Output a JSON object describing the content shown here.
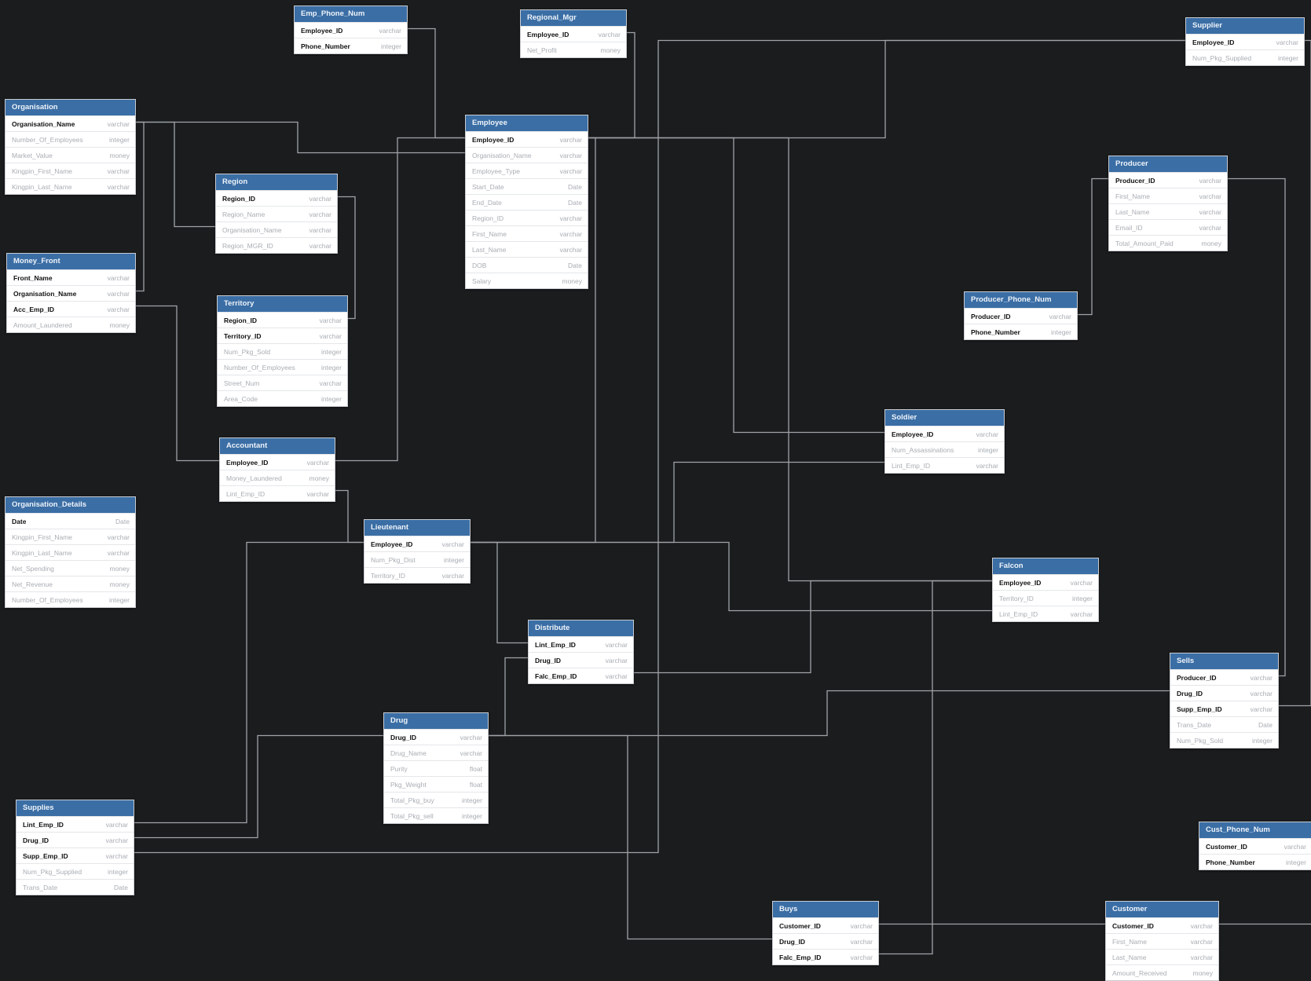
{
  "colors": {
    "background": "#1b1c1e",
    "table_header": "#3b6ea5",
    "table_body": "#ffffff",
    "connector": "#9fa3a8"
  },
  "tables": {
    "emp_phone_num": {
      "name": "Emp_Phone_Num",
      "columns": [
        {
          "name": "Employee_ID",
          "type": "varchar",
          "key": true
        },
        {
          "name": "Phone_Number",
          "type": "integer",
          "key": true
        }
      ]
    },
    "regional_mgr": {
      "name": "Regional_Mgr",
      "columns": [
        {
          "name": "Employee_ID",
          "type": "varchar",
          "key": true
        },
        {
          "name": "Net_Profit",
          "type": "money",
          "key": false
        }
      ]
    },
    "supplier": {
      "name": "Supplier",
      "columns": [
        {
          "name": "Employee_ID",
          "type": "varchar",
          "key": true
        },
        {
          "name": "Num_Pkg_Supplied",
          "type": "integer",
          "key": false
        }
      ]
    },
    "organisation": {
      "name": "Organisation",
      "columns": [
        {
          "name": "Organisation_Name",
          "type": "varchar",
          "key": true
        },
        {
          "name": "Number_Of_Employees",
          "type": "integer",
          "key": false
        },
        {
          "name": "Market_Value",
          "type": "money",
          "key": false
        },
        {
          "name": "Kingpin_First_Name",
          "type": "varchar",
          "key": false
        },
        {
          "name": "Kingpin_Last_Name",
          "type": "varchar",
          "key": false
        }
      ]
    },
    "employee": {
      "name": "Employee",
      "columns": [
        {
          "name": "Employee_ID",
          "type": "varchar",
          "key": true
        },
        {
          "name": "Organisation_Name",
          "type": "varchar",
          "key": false
        },
        {
          "name": "Employee_Type",
          "type": "varchar",
          "key": false
        },
        {
          "name": "Start_Date",
          "type": "Date",
          "key": false
        },
        {
          "name": "End_Date",
          "type": "Date",
          "key": false
        },
        {
          "name": "Region_ID",
          "type": "varchar",
          "key": false
        },
        {
          "name": "First_Name",
          "type": "varchar",
          "key": false
        },
        {
          "name": "Last_Name",
          "type": "varchar",
          "key": false
        },
        {
          "name": "DOB",
          "type": "Date",
          "key": false
        },
        {
          "name": "Salary",
          "type": "money",
          "key": false
        }
      ]
    },
    "producer": {
      "name": "Producer",
      "columns": [
        {
          "name": "Producer_ID",
          "type": "varchar",
          "key": true
        },
        {
          "name": "First_Name",
          "type": "varchar",
          "key": false
        },
        {
          "name": "Last_Name",
          "type": "varchar",
          "key": false
        },
        {
          "name": "Email_ID",
          "type": "varchar",
          "key": false
        },
        {
          "name": "Total_Amount_Paid",
          "type": "money",
          "key": false
        }
      ]
    },
    "region": {
      "name": "Region",
      "columns": [
        {
          "name": "Region_ID",
          "type": "varchar",
          "key": true
        },
        {
          "name": "Region_Name",
          "type": "varchar",
          "key": false
        },
        {
          "name": "Organisation_Name",
          "type": "varchar",
          "key": false
        },
        {
          "name": "Region_MGR_ID",
          "type": "varchar",
          "key": false
        }
      ]
    },
    "money_front": {
      "name": "Money_Front",
      "columns": [
        {
          "name": "Front_Name",
          "type": "varchar",
          "key": true
        },
        {
          "name": "Organisation_Name",
          "type": "varchar",
          "key": true
        },
        {
          "name": "Acc_Emp_ID",
          "type": "varchar",
          "key": true
        },
        {
          "name": "Amount_Laundered",
          "type": "money",
          "key": false
        }
      ]
    },
    "producer_phone_num": {
      "name": "Producer_Phone_Num",
      "columns": [
        {
          "name": "Producer_ID",
          "type": "varchar",
          "key": true
        },
        {
          "name": "Phone_Number",
          "type": "integer",
          "key": true
        }
      ]
    },
    "territory": {
      "name": "Territory",
      "columns": [
        {
          "name": "Region_ID",
          "type": "varchar",
          "key": true
        },
        {
          "name": "Territory_ID",
          "type": "varchar",
          "key": true
        },
        {
          "name": "Num_Pkg_Sold",
          "type": "integer",
          "key": false
        },
        {
          "name": "Number_Of_Employees",
          "type": "integer",
          "key": false
        },
        {
          "name": "Street_Num",
          "type": "varchar",
          "key": false
        },
        {
          "name": "Area_Code",
          "type": "integer",
          "key": false
        }
      ]
    },
    "soldier": {
      "name": "Soldier",
      "columns": [
        {
          "name": "Employee_ID",
          "type": "varchar",
          "key": true
        },
        {
          "name": "Num_Assassinations",
          "type": "integer",
          "key": false
        },
        {
          "name": "Lint_Emp_ID",
          "type": "varchar",
          "key": false
        }
      ]
    },
    "accountant": {
      "name": "Accountant",
      "columns": [
        {
          "name": "Employee_ID",
          "type": "varchar",
          "key": true
        },
        {
          "name": "Money_Laundered",
          "type": "money",
          "key": false
        },
        {
          "name": "Lint_Emp_ID",
          "type": "varchar",
          "key": false
        }
      ]
    },
    "organisation_details": {
      "name": "Organisation_Details",
      "columns": [
        {
          "name": "Date",
          "type": "Date",
          "key": true
        },
        {
          "name": "Kingpin_First_Name",
          "type": "varchar",
          "key": false
        },
        {
          "name": "Kingpin_Last_Name",
          "type": "varchar",
          "key": false
        },
        {
          "name": "Net_Spending",
          "type": "money",
          "key": false
        },
        {
          "name": "Net_Revenue",
          "type": "money",
          "key": false
        },
        {
          "name": "Number_Of_Employees",
          "type": "integer",
          "key": false
        }
      ]
    },
    "lieutenant": {
      "name": "Lieutenant",
      "columns": [
        {
          "name": "Employee_ID",
          "type": "varchar",
          "key": true
        },
        {
          "name": "Num_Pkg_Dist",
          "type": "integer",
          "key": false
        },
        {
          "name": "Territory_ID",
          "type": "varchar",
          "key": false
        }
      ]
    },
    "falcon": {
      "name": "Falcon",
      "columns": [
        {
          "name": "Employee_ID",
          "type": "varchar",
          "key": true
        },
        {
          "name": "Territory_ID",
          "type": "integer",
          "key": false
        },
        {
          "name": "Lint_Emp_ID",
          "type": "varchar",
          "key": false
        }
      ]
    },
    "distribute": {
      "name": "Distribute",
      "columns": [
        {
          "name": "Lint_Emp_ID",
          "type": "varchar",
          "key": true
        },
        {
          "name": "Drug_ID",
          "type": "varchar",
          "key": true
        },
        {
          "name": "Falc_Emp_ID",
          "type": "varchar",
          "key": true
        }
      ]
    },
    "sells": {
      "name": "Sells",
      "columns": [
        {
          "name": "Producer_ID",
          "type": "varchar",
          "key": true
        },
        {
          "name": "Drug_ID",
          "type": "varchar",
          "key": true
        },
        {
          "name": "Supp_Emp_ID",
          "type": "varchar",
          "key": true
        },
        {
          "name": "Trans_Date",
          "type": "Date",
          "key": false
        },
        {
          "name": "Num_Pkg_Sold",
          "type": "integer",
          "key": false
        }
      ]
    },
    "drug": {
      "name": "Drug",
      "columns": [
        {
          "name": "Drug_ID",
          "type": "varchar",
          "key": true
        },
        {
          "name": "Drug_Name",
          "type": "varchar",
          "key": false
        },
        {
          "name": "Purity",
          "type": "float",
          "key": false
        },
        {
          "name": "Pkg_Weight",
          "type": "float",
          "key": false
        },
        {
          "name": "Total_Pkg_buy",
          "type": "integer",
          "key": false
        },
        {
          "name": "Total_Pkg_sell",
          "type": "integer",
          "key": false
        }
      ]
    },
    "supplies": {
      "name": "Supplies",
      "columns": [
        {
          "name": "Lint_Emp_ID",
          "type": "varchar",
          "key": true
        },
        {
          "name": "Drug_ID",
          "type": "varchar",
          "key": true
        },
        {
          "name": "Supp_Emp_ID",
          "type": "varchar",
          "key": true
        },
        {
          "name": "Num_Pkg_Supplied",
          "type": "integer",
          "key": false
        },
        {
          "name": "Trans_Date",
          "type": "Date",
          "key": false
        }
      ]
    },
    "cust_phone_num": {
      "name": "Cust_Phone_Num",
      "columns": [
        {
          "name": "Customer_ID",
          "type": "varchar",
          "key": true
        },
        {
          "name": "Phone_Number",
          "type": "integer",
          "key": true
        }
      ]
    },
    "buys": {
      "name": "Buys",
      "columns": [
        {
          "name": "Customer_ID",
          "type": "varchar",
          "key": true
        },
        {
          "name": "Drug_ID",
          "type": "varchar",
          "key": true
        },
        {
          "name": "Falc_Emp_ID",
          "type": "varchar",
          "key": true
        }
      ]
    },
    "customer": {
      "name": "Customer",
      "columns": [
        {
          "name": "Customer_ID",
          "type": "varchar",
          "key": true
        },
        {
          "name": "First_Name",
          "type": "varchar",
          "key": false
        },
        {
          "name": "Last_Name",
          "type": "varchar",
          "key": false
        },
        {
          "name": "Amount_Received",
          "type": "money",
          "key": false
        }
      ]
    }
  }
}
